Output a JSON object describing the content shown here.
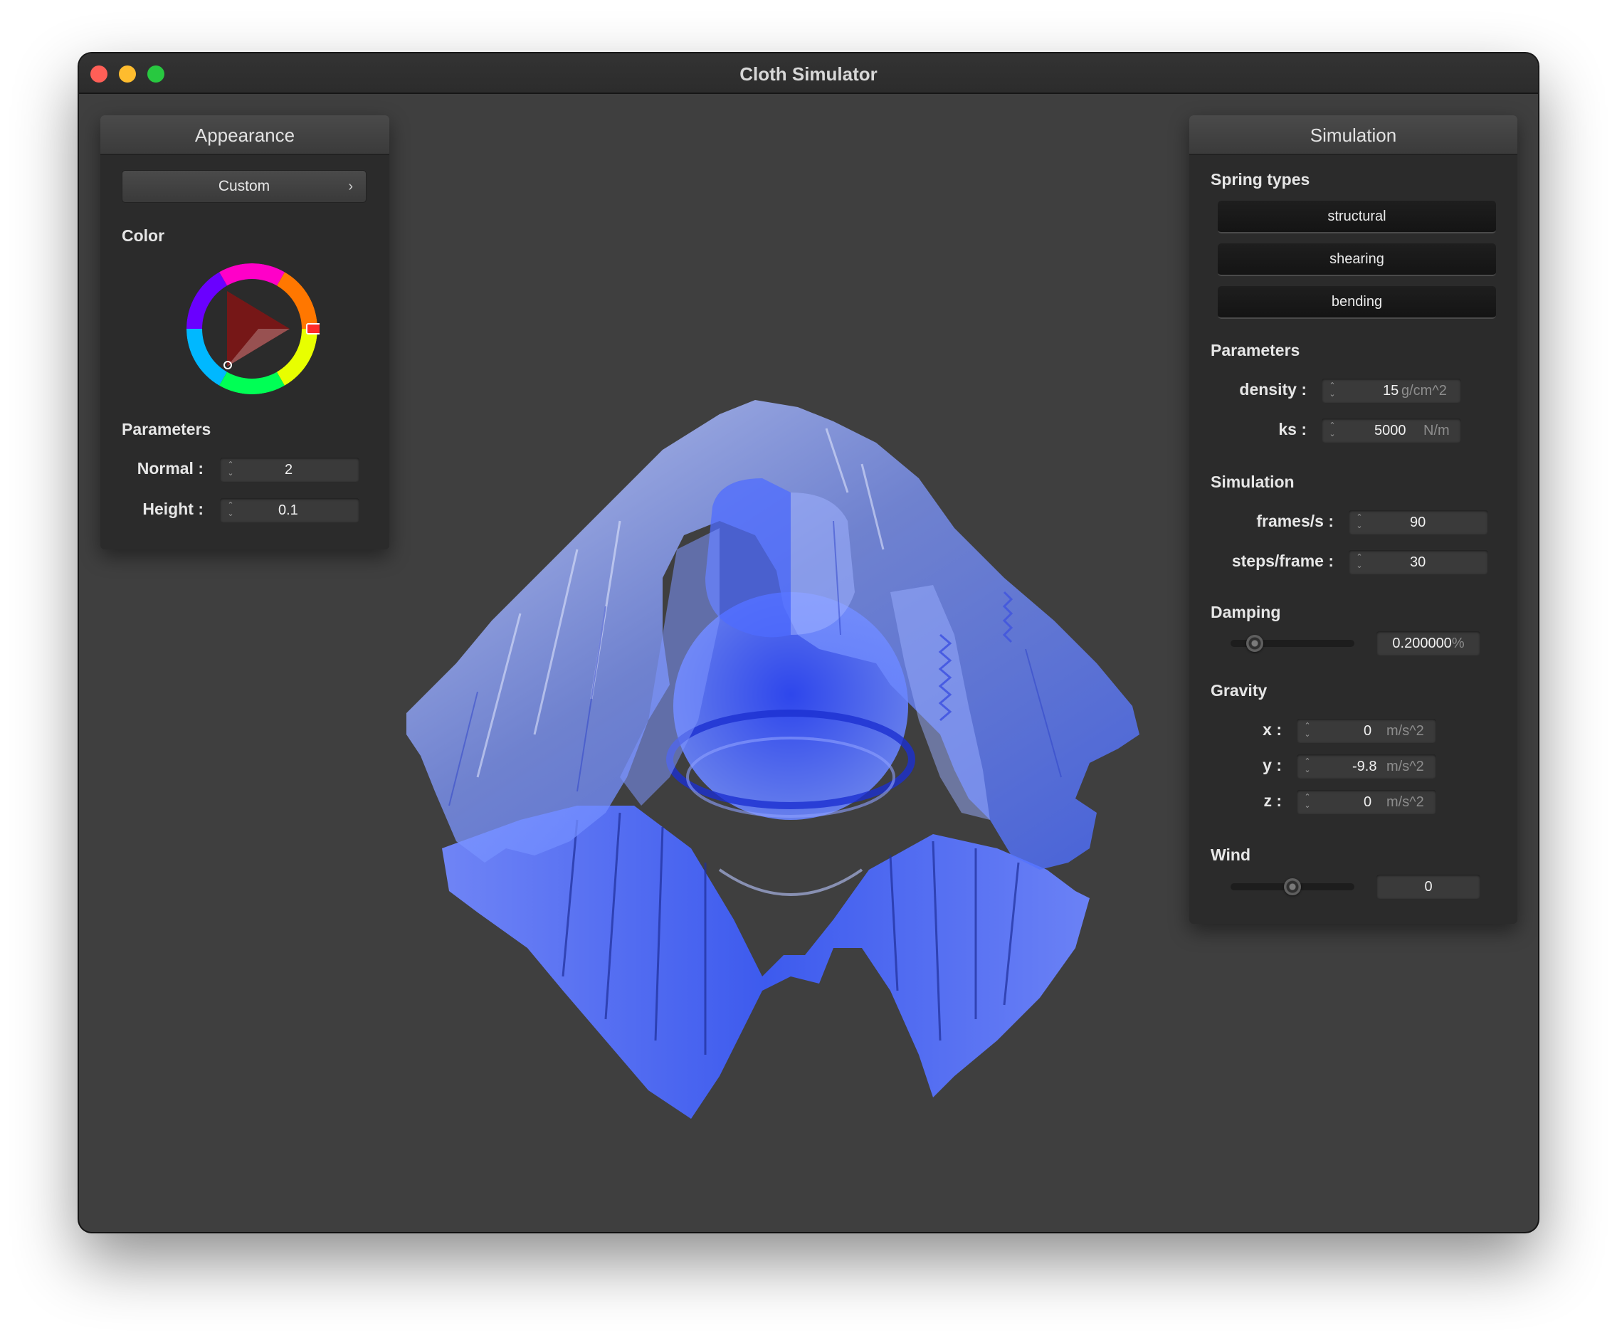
{
  "window": {
    "title": "Cloth Simulator"
  },
  "appearance": {
    "title": "Appearance",
    "shader_dropdown": {
      "value": "Custom",
      "chevron": "›"
    },
    "color_label": "Color",
    "color_wheel": {
      "selected_hue": "#ff0000"
    },
    "parameters_label": "Parameters",
    "normal": {
      "label": "Normal :",
      "value": "2"
    },
    "height": {
      "label": "Height :",
      "value": "0.1"
    }
  },
  "simulation": {
    "title": "Simulation",
    "spring_types_label": "Spring types",
    "spring_buttons": [
      "structural",
      "shearing",
      "bending"
    ],
    "parameters_label": "Parameters",
    "density": {
      "label": "density :",
      "value": "15",
      "unit": "g/cm^2"
    },
    "ks": {
      "label": "ks :",
      "value": "5000",
      "unit": "N/m"
    },
    "simulation_label": "Simulation",
    "frames": {
      "label": "frames/s :",
      "value": "90"
    },
    "steps": {
      "label": "steps/frame :",
      "value": "30"
    },
    "damping_label": "Damping",
    "damping": {
      "value": "0.200000",
      "unit": "%",
      "slider_fraction": 0.2
    },
    "gravity_label": "Gravity",
    "gravity_x": {
      "label": "x :",
      "value": "0",
      "unit": "m/s^2"
    },
    "gravity_y": {
      "label": "y :",
      "value": "-9.8",
      "unit": "m/s^2"
    },
    "gravity_z": {
      "label": "z :",
      "value": "0",
      "unit": "m/s^2"
    },
    "wind_label": "Wind",
    "wind": {
      "value": "0",
      "slider_fraction": 0.5
    }
  },
  "icons": {
    "spin_up": "⌃",
    "spin_down": "⌄"
  },
  "colors": {
    "cloth": "#3b5cff",
    "background": "#3f3f3f",
    "panel": "#2b2b2b"
  }
}
